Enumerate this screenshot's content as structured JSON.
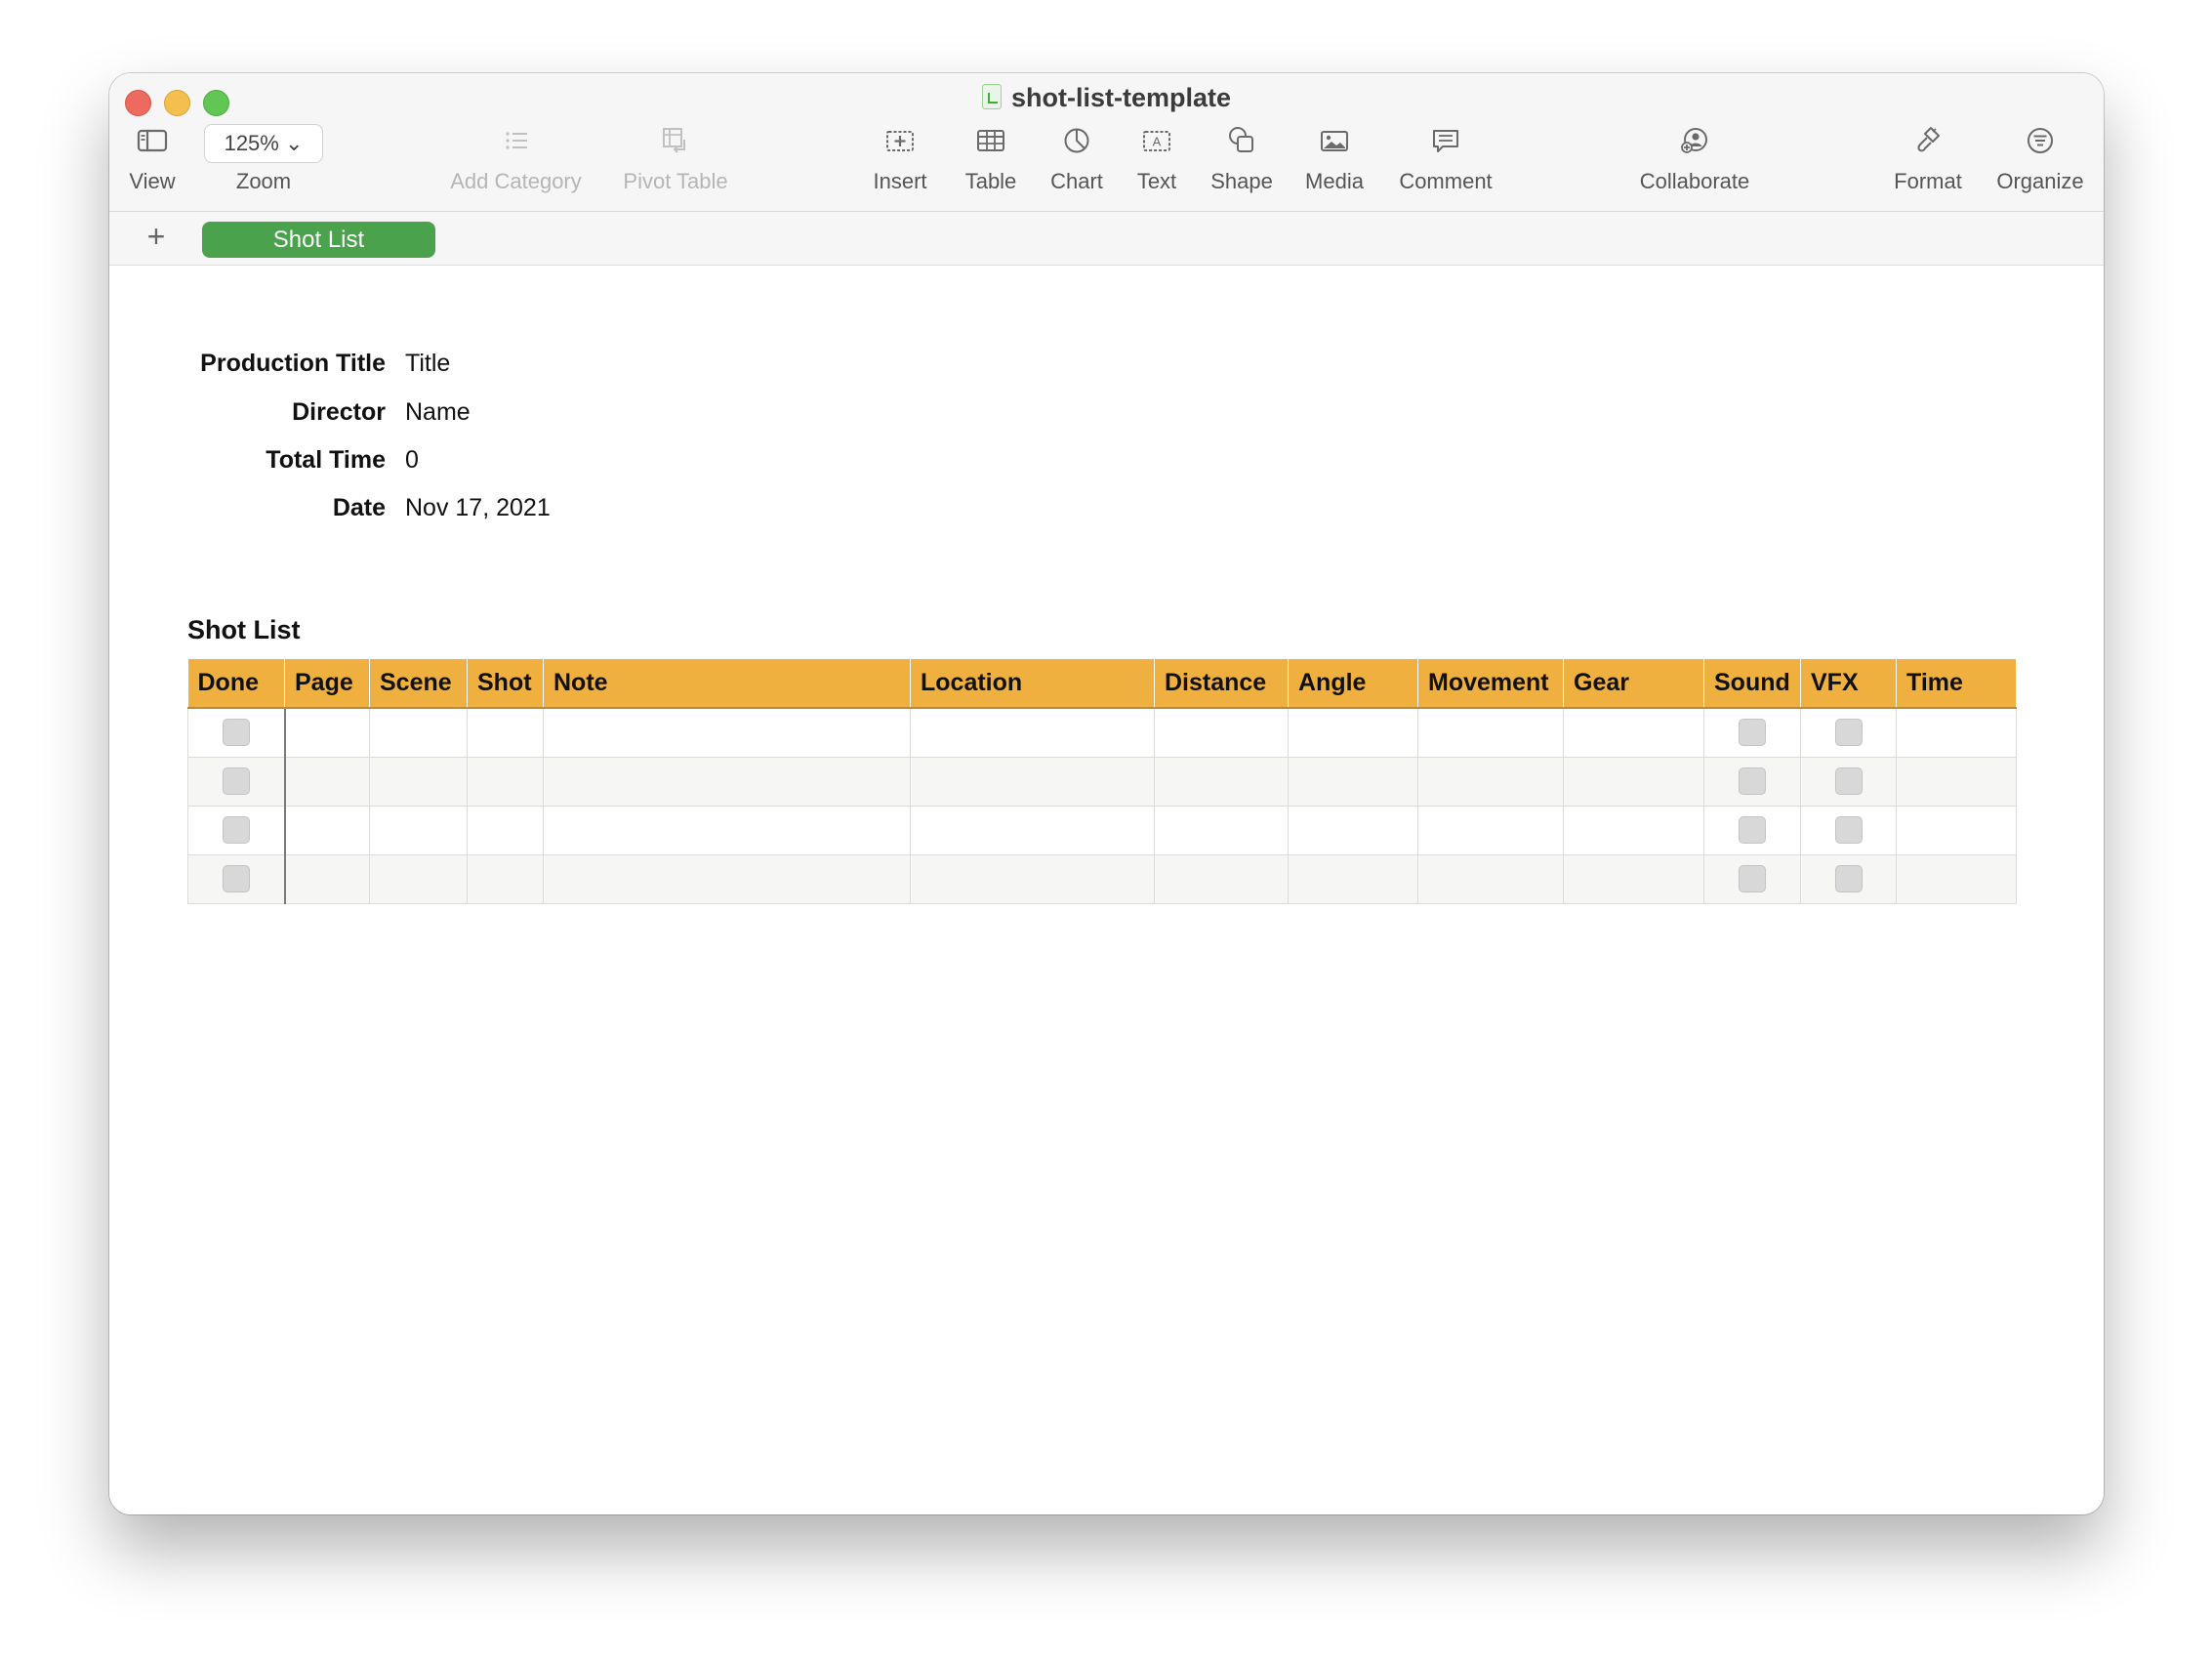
{
  "window": {
    "title": "shot-list-template"
  },
  "toolbar": {
    "view": {
      "label": "View",
      "icon": "sidebar-icon"
    },
    "zoom": {
      "label": "Zoom",
      "value": "125%"
    },
    "add_category": {
      "label": "Add Category",
      "icon": "list-icon"
    },
    "pivot_table": {
      "label": "Pivot Table",
      "icon": "pivot-table-icon"
    },
    "insert": {
      "label": "Insert",
      "icon": "insert-icon"
    },
    "table": {
      "label": "Table",
      "icon": "table-icon"
    },
    "chart": {
      "label": "Chart",
      "icon": "chart-icon"
    },
    "text": {
      "label": "Text",
      "icon": "text-icon"
    },
    "shape": {
      "label": "Shape",
      "icon": "shape-icon"
    },
    "media": {
      "label": "Media",
      "icon": "media-icon"
    },
    "comment": {
      "label": "Comment",
      "icon": "comment-icon"
    },
    "collaborate": {
      "label": "Collaborate",
      "icon": "collaborate-icon"
    },
    "format": {
      "label": "Format",
      "icon": "format-brush-icon"
    },
    "organize": {
      "label": "Organize",
      "icon": "organize-icon"
    }
  },
  "sheets": {
    "add_label": "+",
    "active_tab": "Shot List",
    "active_color": "#4aa24d"
  },
  "info": [
    {
      "label": "Production Title",
      "value": "Title"
    },
    {
      "label": "Director",
      "value": "Name"
    },
    {
      "label": "Total Time",
      "value": "0"
    },
    {
      "label": "Date",
      "value": "Nov 17, 2021"
    }
  ],
  "table": {
    "title": "Shot List",
    "header_color": "#f0b040",
    "columns": [
      "Done",
      "Page",
      "Scene",
      "Shot",
      "Note",
      "Location",
      "Distance",
      "Angle",
      "Movement",
      "Gear",
      "Sound",
      "VFX",
      "Time"
    ],
    "rows": [
      {
        "done": false,
        "sound": false,
        "vfx": false
      },
      {
        "done": false,
        "sound": false,
        "vfx": false
      },
      {
        "done": false,
        "sound": false,
        "vfx": false
      },
      {
        "done": false,
        "sound": false,
        "vfx": false
      }
    ]
  }
}
